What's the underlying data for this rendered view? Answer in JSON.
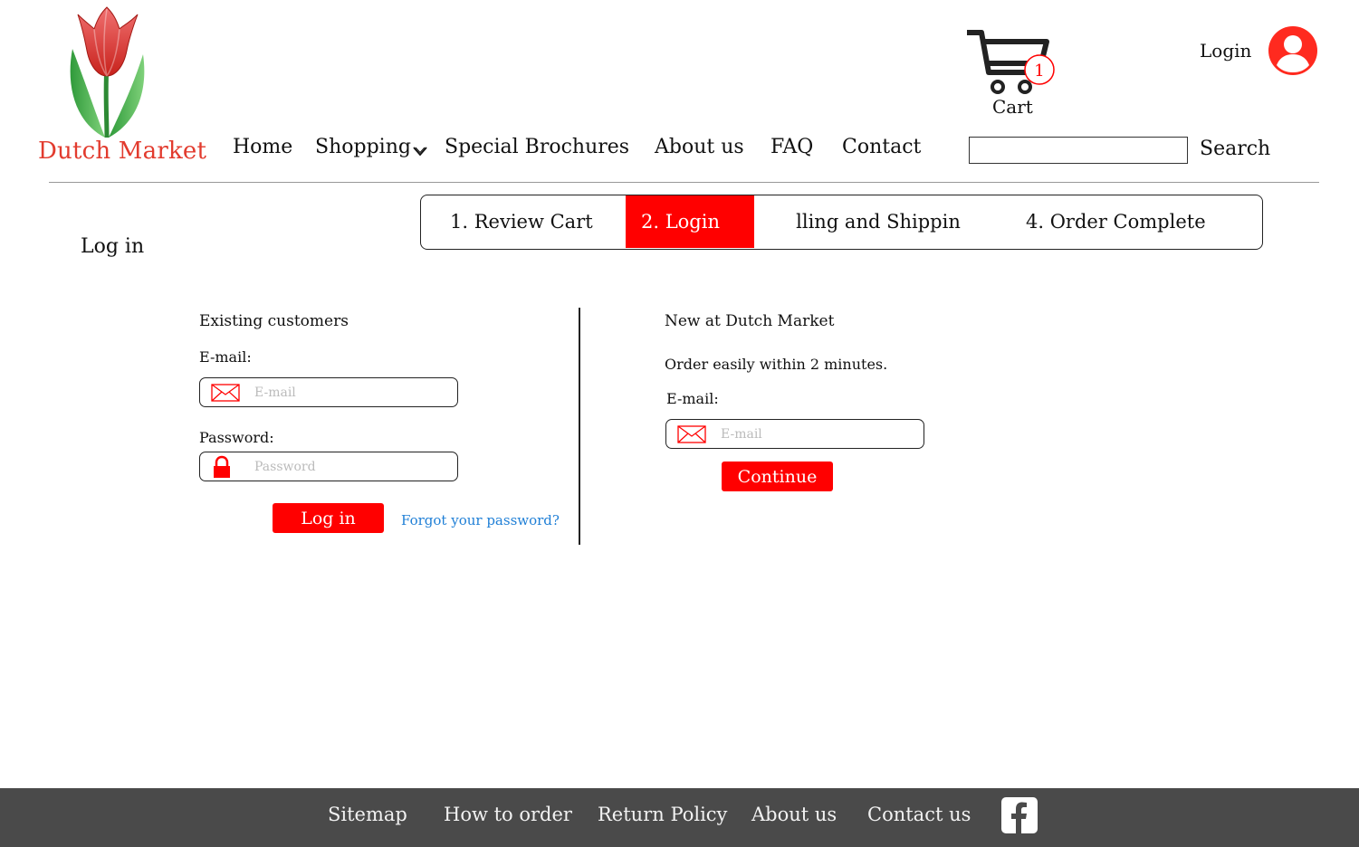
{
  "brand": {
    "name": "Dutch Market",
    "accent": "#ff0000",
    "logo_text_color": "#e23b2e"
  },
  "nav": {
    "items": [
      {
        "label": "Home"
      },
      {
        "label": "Shopping"
      },
      {
        "label": "Special Brochures"
      },
      {
        "label": "About us"
      },
      {
        "label": "FAQ"
      },
      {
        "label": "Contact"
      }
    ],
    "shopping_dropdown_icon": "chevron-down-icon"
  },
  "cart": {
    "label": "Cart",
    "count": "1",
    "icon": "cart-icon"
  },
  "account": {
    "login_label": "Login",
    "icon": "user-circle-icon"
  },
  "search": {
    "value": "",
    "placeholder": "",
    "button_label": "Search"
  },
  "steps": {
    "items": [
      {
        "label": "1. Review Cart",
        "active": false
      },
      {
        "label": "2. Login",
        "active": true
      },
      {
        "label": "lling and Shippin",
        "active": false
      },
      {
        "label": "4. Order Complete",
        "active": false
      }
    ]
  },
  "page": {
    "title": "Log in"
  },
  "existing": {
    "heading": "Existing customers",
    "email_label": "E-mail:",
    "email_placeholder": "E-mail",
    "email_icon": "envelope-icon",
    "password_label": "Password:",
    "password_placeholder": "Password",
    "password_icon": "lock-icon",
    "login_button": "Log in",
    "forgot_link": "Forgot your password?"
  },
  "new_customer": {
    "heading": "New at Dutch Market",
    "description": "Order easily within 2 minutes.",
    "email_label": "E-mail:",
    "email_placeholder": "E-mail",
    "email_icon": "envelope-icon",
    "continue_button": "Continue"
  },
  "footer": {
    "links": [
      {
        "label": "Sitemap"
      },
      {
        "label": "How to order"
      },
      {
        "label": "Return Policy"
      },
      {
        "label": "About us"
      },
      {
        "label": "Contact us"
      }
    ],
    "social_icon": "facebook-icon",
    "background": "#4a4a4a"
  }
}
